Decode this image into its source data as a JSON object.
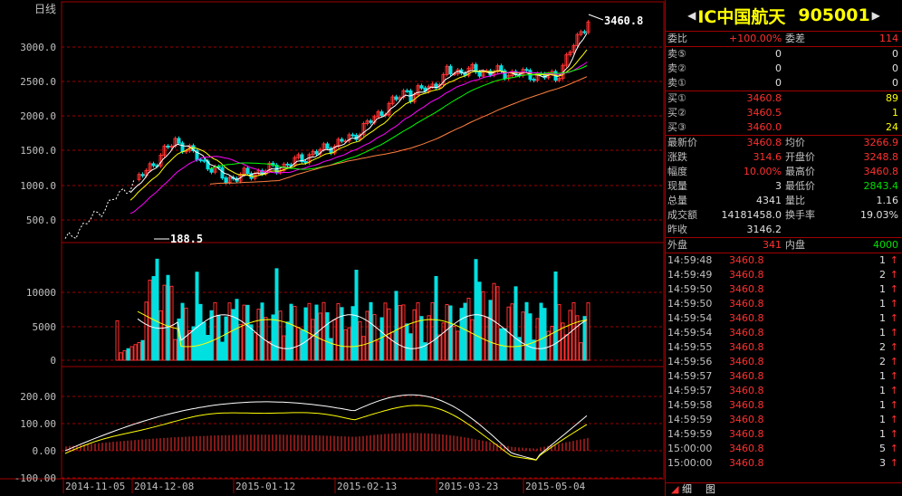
{
  "chart": {
    "period_label": "日线",
    "price_axis": [
      "3000.0",
      "2500.0",
      "2000.0",
      "1500.0",
      "1000.0",
      "500.0"
    ],
    "vol_axis": [
      "10000",
      "5000",
      "0"
    ],
    "macd_axis": [
      "200.00",
      "100.00",
      "0.00",
      "-100.00"
    ],
    "date_axis": [
      "2014-11-05",
      "2014-12-08",
      "2015-01-12",
      "2015-02-13",
      "2015-03-23",
      "2015-05-04"
    ],
    "high_label": "3460.8",
    "low_label": "188.5"
  },
  "quote": {
    "name": "IC中国航天",
    "code": "905001",
    "weibi_label": "委比",
    "weibi_value": "+100.00%",
    "weicha_label": "委差",
    "weicha_value": "114",
    "asks": [
      {
        "label": "卖⑤",
        "price": "0",
        "vol": "0"
      },
      {
        "label": "卖②",
        "price": "0",
        "vol": "0"
      },
      {
        "label": "卖①",
        "price": "0",
        "vol": "0"
      }
    ],
    "bids": [
      {
        "label": "买①",
        "price": "3460.8",
        "vol": "89"
      },
      {
        "label": "买②",
        "price": "3460.5",
        "vol": "1"
      },
      {
        "label": "买③",
        "price": "3460.0",
        "vol": "24"
      }
    ],
    "latest_label": "最新价",
    "latest": "3460.8",
    "avg_label": "均价",
    "avg": "3266.9",
    "change_label": "涨跌",
    "change": "314.6",
    "open_label": "开盘价",
    "open": "3248.8",
    "pct_label": "幅度",
    "pct": "10.00%",
    "high_label": "最高价",
    "high": "3460.8",
    "curvol_label": "现量",
    "curvol": "3",
    "low_label": "最低价",
    "low": "2843.4",
    "totvol_label": "总量",
    "totvol": "4341",
    "ratio_label": "量比",
    "ratio": "1.16",
    "amount_label": "成交额",
    "amount": "14181458.0",
    "turnover_label": "换手率",
    "turnover": "19.03%",
    "prev_label": "昨收",
    "prev": "3146.2",
    "outer_label": "外盘",
    "outer": "341",
    "inner_label": "内盘",
    "inner": "4000"
  },
  "ticks": [
    {
      "t": "14:59:48",
      "p": "3460.8",
      "v": "1"
    },
    {
      "t": "14:59:49",
      "p": "3460.8",
      "v": "2"
    },
    {
      "t": "14:59:50",
      "p": "3460.8",
      "v": "1"
    },
    {
      "t": "14:59:50",
      "p": "3460.8",
      "v": "1"
    },
    {
      "t": "14:59:54",
      "p": "3460.8",
      "v": "1"
    },
    {
      "t": "14:59:54",
      "p": "3460.8",
      "v": "1"
    },
    {
      "t": "14:59:55",
      "p": "3460.8",
      "v": "2"
    },
    {
      "t": "14:59:56",
      "p": "3460.8",
      "v": "2"
    },
    {
      "t": "14:59:57",
      "p": "3460.8",
      "v": "1"
    },
    {
      "t": "14:59:57",
      "p": "3460.8",
      "v": "1"
    },
    {
      "t": "14:59:58",
      "p": "3460.8",
      "v": "1"
    },
    {
      "t": "14:59:59",
      "p": "3460.8",
      "v": "1"
    },
    {
      "t": "14:59:59",
      "p": "3460.8",
      "v": "1"
    },
    {
      "t": "15:00:00",
      "p": "3460.8",
      "v": "5"
    },
    {
      "t": "15:00:00",
      "p": "3460.8",
      "v": "3"
    }
  ],
  "tabs": {
    "detail": "细",
    "chart": "图"
  },
  "colors": {
    "up": "#ff3030",
    "down": "#00e0e0",
    "grid": "#a00000",
    "macd_up": "#ff3030",
    "macd_down": "#00e000"
  }
}
